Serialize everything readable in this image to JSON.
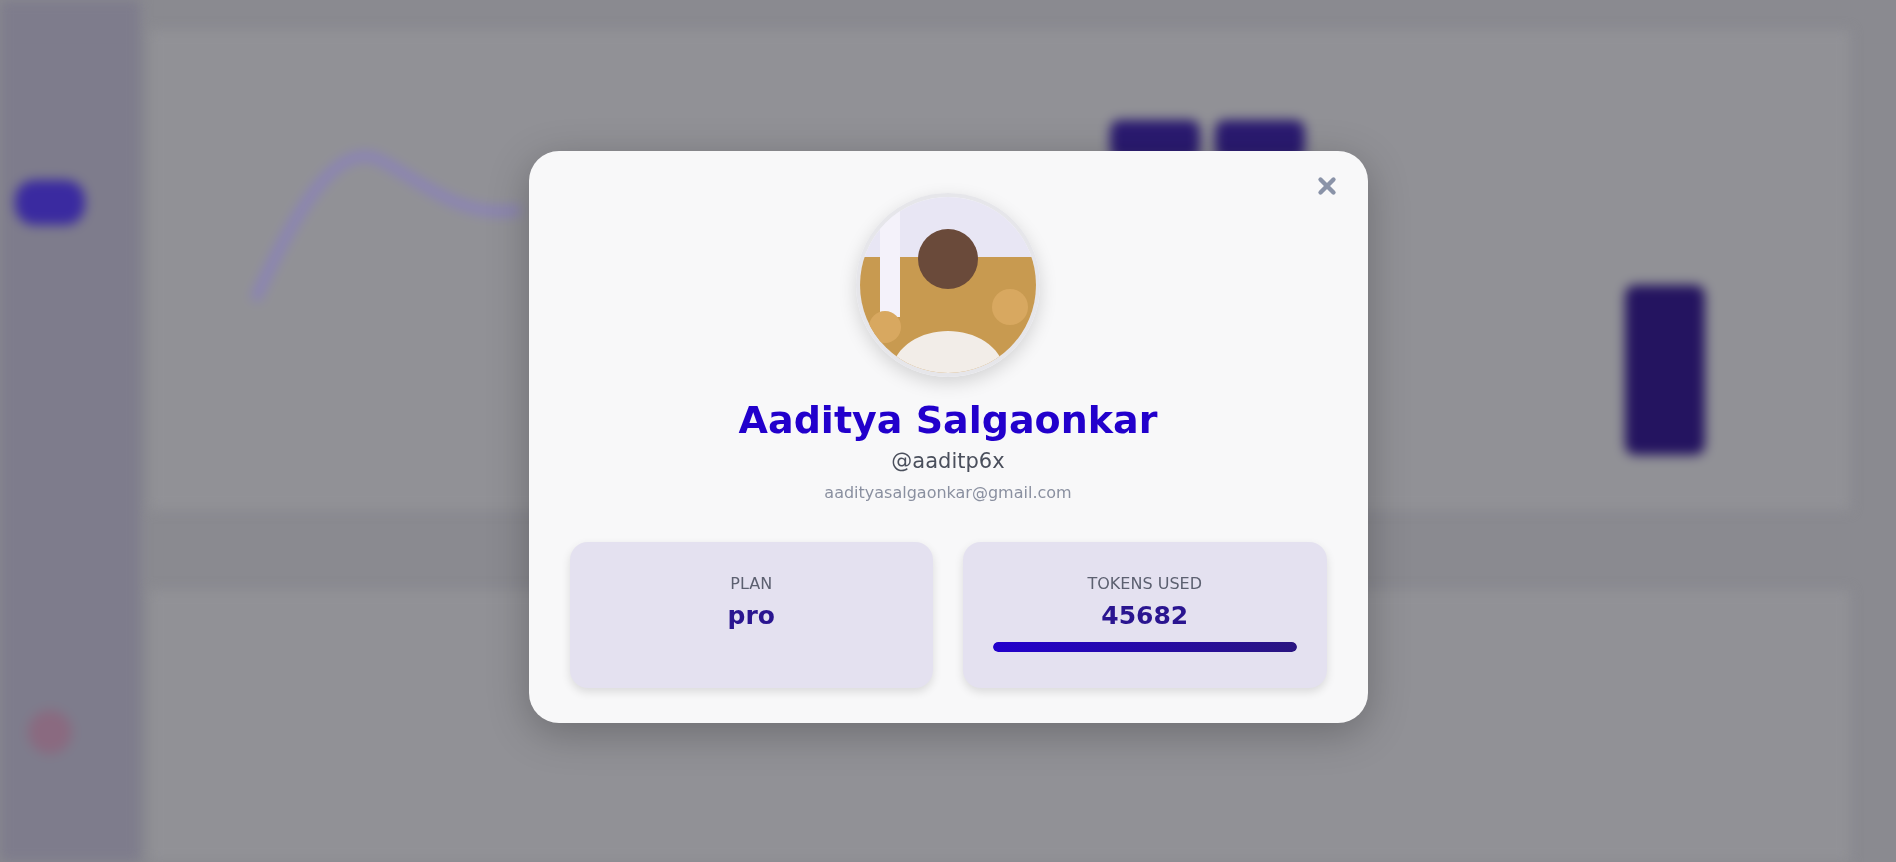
{
  "profile_modal": {
    "name": "Aaditya Salgaonkar",
    "username": "@aaditp6x",
    "email": "aadityasalgaonkar@gmail.com",
    "stats": [
      {
        "kind": "text",
        "label": "PLAN",
        "value": "pro"
      },
      {
        "kind": "meter",
        "label": "TOKENS USED",
        "value": "45682",
        "level": 1
      }
    ]
  }
}
